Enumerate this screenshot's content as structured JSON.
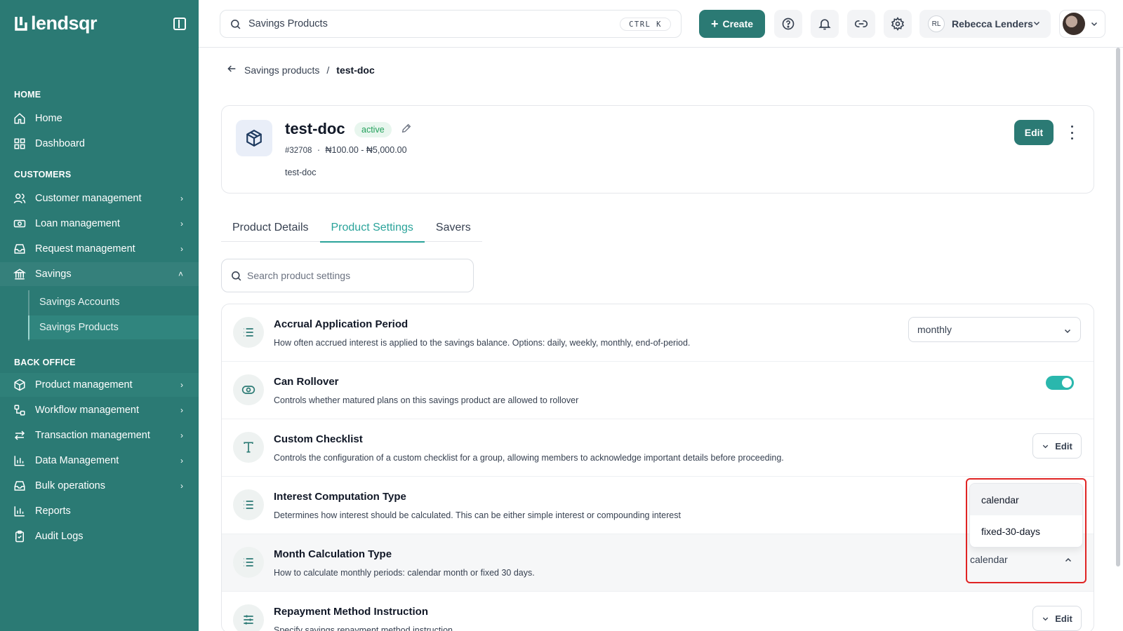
{
  "app": {
    "logo_text": "lendsqr"
  },
  "topbar": {
    "search_value": "Savings Products",
    "shortcut": "CTRL K",
    "create_label": "Create",
    "user_initials": "RL",
    "user_name": "Rebecca Lenders"
  },
  "sidebar": {
    "sections": {
      "home": "HOME",
      "customers": "CUSTOMERS",
      "back_office": "BACK OFFICE"
    },
    "items": {
      "home": "Home",
      "dashboard": "Dashboard",
      "customer_management": "Customer management",
      "loan_management": "Loan management",
      "request_management": "Request management",
      "savings": "Savings",
      "savings_accounts": "Savings Accounts",
      "savings_products": "Savings Products",
      "product_management": "Product management",
      "workflow_management": "Workflow management",
      "transaction_management": "Transaction management",
      "data_management": "Data Management",
      "bulk_operations": "Bulk operations",
      "reports": "Reports",
      "audit_logs": "Audit Logs"
    }
  },
  "breadcrumb": {
    "parent": "Savings products",
    "separator": "/",
    "current": "test-doc"
  },
  "product": {
    "name": "test-doc",
    "status": "active",
    "id": "#32708",
    "meta_sep": "·",
    "range": "₦100.00 - ₦5,000.00",
    "description": "test-doc",
    "edit_label": "Edit"
  },
  "tabs": [
    "Product Details",
    "Product Settings",
    "Savers"
  ],
  "settings_search": {
    "placeholder": "Search product settings"
  },
  "settings": [
    {
      "title": "Accrual Application Period",
      "desc": "How often accrued interest is applied to the savings balance. Options: daily, weekly, monthly, end-of-period.",
      "control_value": "monthly"
    },
    {
      "title": "Can Rollover",
      "desc": "Controls whether matured plans on this savings product are allowed to rollover",
      "toggle_on": true
    },
    {
      "title": "Custom Checklist",
      "desc": "Controls the configuration of a custom checklist for a group, allowing members to acknowledge important details before proceeding.",
      "button_label": "Edit"
    },
    {
      "title": "Interest Computation Type",
      "desc": "Determines how interest should be calculated. This can be either simple interest or compounding interest"
    },
    {
      "title": "Month Calculation Type",
      "desc": "How to calculate monthly periods: calendar month or fixed 30 days.",
      "control_value": "calendar"
    },
    {
      "title": "Repayment Method Instruction",
      "desc": "Specify savings repayment method instruction",
      "button_label": "Edit"
    }
  ],
  "dropdown": {
    "options": [
      "calendar",
      "fixed-30-days"
    ],
    "selected": "calendar"
  },
  "colors": {
    "brand": "#2b7a74",
    "accent": "#2aa39a",
    "active_badge": "#22a05b",
    "highlight": "#e02424"
  }
}
